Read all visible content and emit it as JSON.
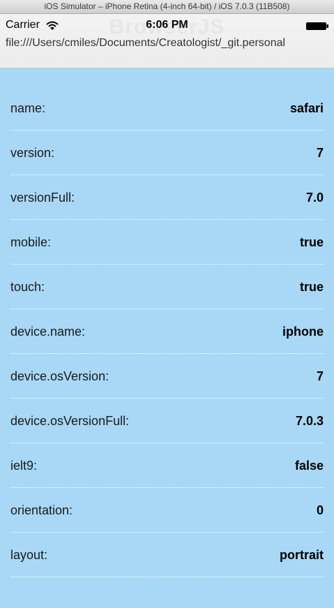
{
  "window": {
    "title": "iOS Simulator – iPhone Retina (4-inch 64-bit) / iOS 7.0.3 (11B508)"
  },
  "status_bar": {
    "carrier": "Carrier",
    "time": "6:06 PM",
    "wifi_icon": "wifi-icon",
    "battery_icon": "battery-icon"
  },
  "browser": {
    "watermark_title": "BrowserJS",
    "url": "file:///Users/cmiles/Documents/Creatologist/_git.personal"
  },
  "properties": [
    {
      "key": "name:",
      "value": "safari"
    },
    {
      "key": "version:",
      "value": "7"
    },
    {
      "key": "versionFull:",
      "value": "7.0"
    },
    {
      "key": "mobile:",
      "value": "true"
    },
    {
      "key": "touch:",
      "value": "true"
    },
    {
      "key": "device.name:",
      "value": "iphone"
    },
    {
      "key": "device.osVersion:",
      "value": "7"
    },
    {
      "key": "device.osVersionFull:",
      "value": "7.0.3"
    },
    {
      "key": "ielt9:",
      "value": "false"
    },
    {
      "key": "orientation:",
      "value": "0"
    },
    {
      "key": "layout:",
      "value": "portrait"
    }
  ],
  "colors": {
    "background": "#a8d8f5",
    "divider": "#ffffff"
  }
}
